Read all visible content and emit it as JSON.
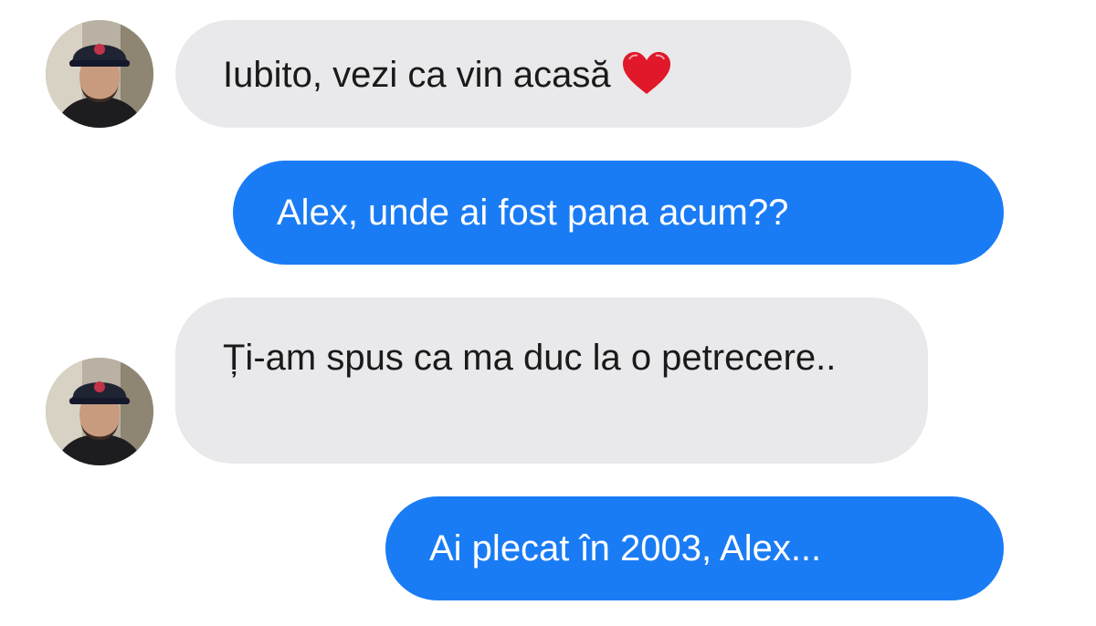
{
  "messages": [
    {
      "sender": "contact",
      "text": "Iubito, vezi ca vin acasă",
      "emoji": "red-heart-icon"
    },
    {
      "sender": "me",
      "text": "Alex, unde ai fost pana acum??"
    },
    {
      "sender": "contact",
      "text": "Ți-am spus ca ma duc la o petrecere.."
    },
    {
      "sender": "me",
      "text": "Ai plecat în 2003, Alex..."
    }
  ],
  "colors": {
    "incoming_bubble": "#e9e9eb",
    "outgoing_bubble": "#1a7cf5",
    "incoming_text": "#1a1a1a",
    "outgoing_text": "#ffffff",
    "heart": "#e0182a"
  }
}
